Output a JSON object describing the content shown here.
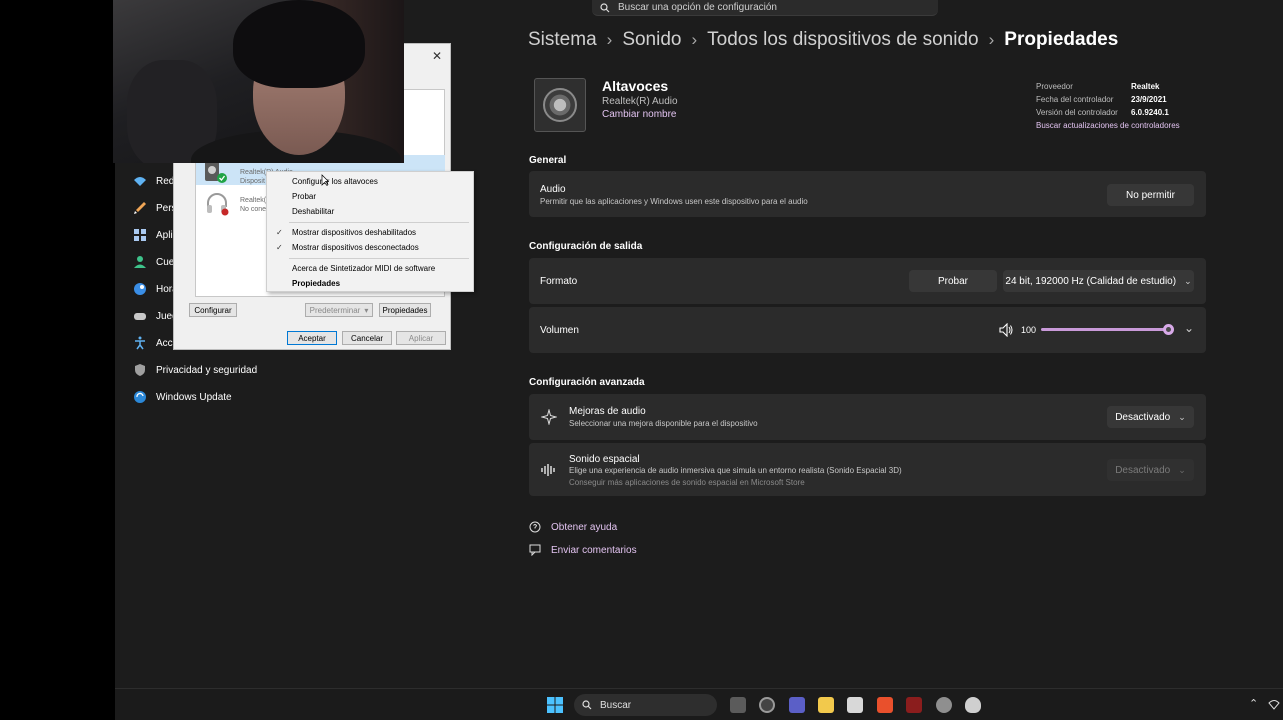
{
  "search": {
    "placeholder": "Buscar una opción de configuración"
  },
  "breadcrumb": [
    "Sistema",
    "Sonido",
    "Todos los dispositivos de sonido",
    "Propiedades"
  ],
  "device": {
    "name": "Altavoces",
    "driver": "Realtek(R) Audio",
    "rename_link": "Cambiar nombre",
    "properties": [
      {
        "label": "Proveedor",
        "value": "Realtek"
      },
      {
        "label": "Fecha del controlador",
        "value": "23/9/2021"
      },
      {
        "label": "Versión del controlador",
        "value": "6.0.9240.1"
      }
    ],
    "driver_link": "Buscar actualizaciones de controladores"
  },
  "general": {
    "heading": "General",
    "audio_title": "Audio",
    "audio_desc": "Permitir que las aplicaciones y Windows usen este dispositivo para el audio",
    "audio_button": "No permitir"
  },
  "output": {
    "heading": "Configuración de salida",
    "format_title": "Formato",
    "test_button": "Probar",
    "format_value": "24 bit, 192000 Hz (Calidad de estudio)",
    "volume_title": "Volumen",
    "volume_value": "100",
    "volume_level_percent": 100
  },
  "advanced": {
    "heading": "Configuración avanzada",
    "enhance_title": "Mejoras de audio",
    "enhance_desc": "Seleccionar una mejora disponible para el dispositivo",
    "enhance_value": "Desactivado",
    "spatial_title": "Sonido espacial",
    "spatial_desc": "Elige una experiencia de audio inmersiva que simula un entorno realista (Sonido Espacial 3D)",
    "spatial_desc2": "Conseguir más aplicaciones de sonido espacial en Microsoft Store",
    "spatial_value": "Desactivado"
  },
  "help": {
    "get_help": "Obtener ayuda",
    "feedback": "Enviar comentarios"
  },
  "nav": [
    "Red",
    "Pers",
    "Aplic",
    "Cuei",
    "Hora",
    "Jueg",
    "Acce",
    "Privacidad y seguridad",
    "Windows Update"
  ],
  "dialog": {
    "close": "✕",
    "device1_line1": "Realtek(R) Audio",
    "device1_line2": "Disposit",
    "device2_line1": "Realtek(",
    "device2_line2": "No cone",
    "btn_configure": "Configurar",
    "btn_default": "Predeterminar",
    "btn_properties": "Propiedades",
    "btn_ok": "Aceptar",
    "btn_cancel": "Cancelar",
    "btn_apply": "Aplicar"
  },
  "context_menu": {
    "configure": "Configurar los altavoces",
    "test": "Probar",
    "disable": "Deshabilitar",
    "show_disabled": "Mostrar dispositivos deshabilitados",
    "show_disconnected": "Mostrar dispositivos desconectados",
    "about_midi": "Acerca de Sintetizador MIDI de software",
    "properties": "Propiedades"
  },
  "taskbar": {
    "search_label": "Buscar"
  },
  "colors": {
    "accent": "#d7a9e8",
    "link": "#e2c3f0",
    "background": "#1c1c1c",
    "card": "#2b2b2b"
  }
}
